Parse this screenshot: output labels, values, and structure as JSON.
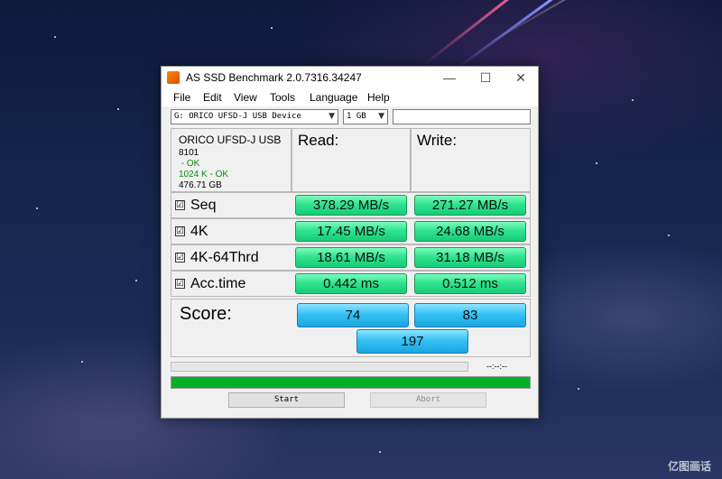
{
  "window": {
    "title": "AS SSD Benchmark 2.0.7316.34247",
    "minimize_glyph": "—",
    "maximize_glyph": "☐",
    "close_glyph": "✕"
  },
  "menu": [
    "File",
    "Edit",
    "View",
    "Tools",
    "Language",
    "Help"
  ],
  "toolbar": {
    "drive_select": "G: ORICO UFSD-J USB Device",
    "size_select": "1 GB",
    "text_value": ""
  },
  "drive_info": {
    "name": "ORICO UFSD-J USB",
    "firmware": "8101",
    "status_1": " - OK",
    "status_2": "1024 K - OK",
    "capacity": "476.71 GB"
  },
  "headers": {
    "read": "Read:",
    "write": "Write:"
  },
  "tests": [
    {
      "label": "Seq",
      "checked": "☑",
      "read": "378.29 MB/s",
      "write": "271.27 MB/s"
    },
    {
      "label": "4K",
      "checked": "☑",
      "read": "17.45 MB/s",
      "write": "24.68 MB/s"
    },
    {
      "label": "4K-64Thrd",
      "checked": "☑",
      "read": "18.61 MB/s",
      "write": "31.18 MB/s"
    },
    {
      "label": "Acc.time",
      "checked": "☑",
      "read": "0.442 ms",
      "write": "0.512 ms"
    }
  ],
  "score": {
    "label": "Score:",
    "read": "74",
    "write": "83",
    "total": "197"
  },
  "progress": {
    "time": "--:--:--",
    "total_fraction": 1.0
  },
  "buttons": {
    "start": "Start",
    "abort": "Abort"
  },
  "watermark": "亿图画话",
  "colors": {
    "result_green": "#31e38f",
    "score_blue": "#35c1f2",
    "progress_green": "#06b025"
  }
}
